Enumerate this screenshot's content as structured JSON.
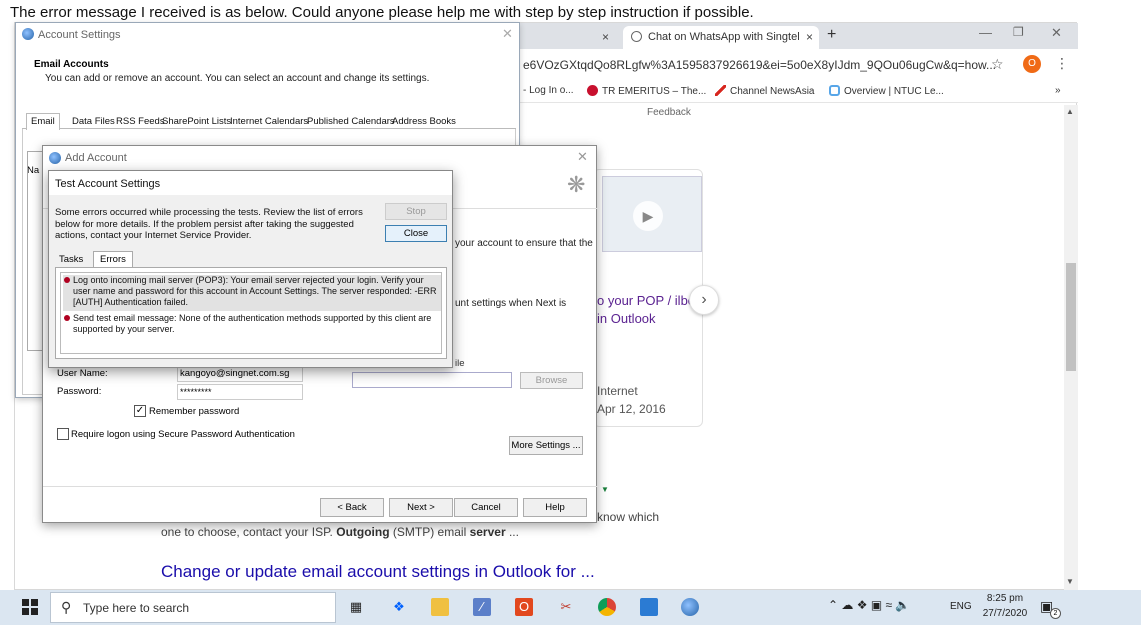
{
  "post": {
    "text": "The error message I received is as below. Could anyone please help me with step by step instruction if possible."
  },
  "browser": {
    "tab_a_close": "×",
    "tab_b_title": "Chat on WhatsApp with Singtel",
    "tab_b_close": "×",
    "new_tab": "+",
    "url": "e6VOzGXtqdQo8RLgfw%3A1595837926619&ei=5o0eX8yIJdm_9QOu06ugCw&q=how...",
    "profile_initial": "O",
    "bookmarks": [
      "- Log In o...",
      "TR EMERITUS – The...",
      "Channel NewsAsia",
      "Overview | NTUC Le..."
    ],
    "bookmarks_more": "»",
    "feedback": "Feedback",
    "card": {
      "title": "o your POP / ilbox in Outlook",
      "source": "Internet",
      "date": "Apr 12, 2016"
    },
    "snippet_line1": "know which",
    "snippet_line2_pre": "one to choose, contact your ISP. ",
    "snippet_line2_bold": "Outgoing",
    "snippet_line2_mid": " (SMTP) email ",
    "snippet_line2_bold2": "server",
    "snippet_line2_end": " ...",
    "result_link": "Change or update email account settings in Outlook for ..."
  },
  "account_settings": {
    "title": "Account Settings",
    "heading": "Email Accounts",
    "subtitle": "You can add or remove an account. You can select an account and change its settings.",
    "tabs": [
      "Email",
      "Data Files",
      "RSS Feeds",
      "SharePoint Lists",
      "Internet Calendars",
      "Published Calendars",
      "Address Books"
    ],
    "list_header_fragment": "Na"
  },
  "add_account": {
    "title": "Add Account",
    "desc_1": "your account to ensure that the",
    "desc_2": "unt settings when Next is",
    "file_label": "ile",
    "browse": "Browse",
    "username_label": "User Name:",
    "username_value": "kangoyo@singnet.com.sg",
    "password_label": "Password:",
    "password_value": "*********",
    "remember_label": "Remember password",
    "remember_checked": "✓",
    "spa_label": "Require logon using Secure Password Authentication",
    "more_settings": "More Settings ...",
    "back": "< Back",
    "next": "Next >",
    "cancel": "Cancel",
    "help": "Help"
  },
  "test_settings": {
    "title": "Test Account Settings",
    "message": "Some errors occurred while processing the tests. Review the list of errors below for more details. If the problem persist after taking the suggested actions, contact your Internet Service Provider.",
    "stop": "Stop",
    "close": "Close",
    "tab_tasks": "Tasks",
    "tab_errors": "Errors",
    "errors": [
      "Log onto incoming mail server (POP3): Your email server rejected your login. Verify your user name and password for this account in Account Settings.  The server responded: -ERR [AUTH] Authentication failed.",
      "Send test email message: None of the authentication methods supported by this client are supported by your server."
    ]
  },
  "taskbar": {
    "search_placeholder": "Type here to search",
    "language": "ENG",
    "time": "8:25 pm",
    "date": "27/7/2020",
    "notification_count": "2"
  },
  "colors": {
    "link": "#1a0dab",
    "visited": "#5b2391",
    "error": "#b00020",
    "taskbar": "#dbe6f1"
  }
}
